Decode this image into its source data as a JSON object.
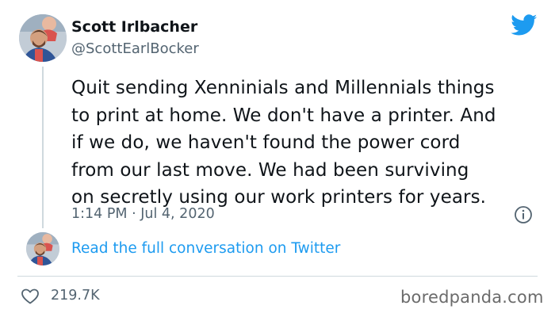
{
  "author": {
    "display_name": "Scott Irlbacher",
    "handle": "@ScottEarlBocker",
    "avatar_icon": "avatar-photo"
  },
  "tweet": {
    "text": "Quit sending Xenninials and Millennials things\nto print at home. We don't have a printer. And\nif we do, we haven't found the power cord\nfrom our last move. We had been surviving\non secretly using our work printers for years.",
    "time": "1:14 PM",
    "separator": "·",
    "date": "Jul 4, 2020"
  },
  "conversation": {
    "link_label": "Read the full conversation on Twitter"
  },
  "stats": {
    "likes": "219.7K"
  },
  "icons": {
    "brand": "twitter-bird-icon",
    "info": "info-icon",
    "like": "heart-icon"
  },
  "colors": {
    "twitter_blue": "#1d9bf0",
    "text_primary": "#0f1419",
    "text_secondary": "#536471",
    "divider": "#cfd9de"
  },
  "watermark": {
    "text": "boredpanda.com"
  }
}
